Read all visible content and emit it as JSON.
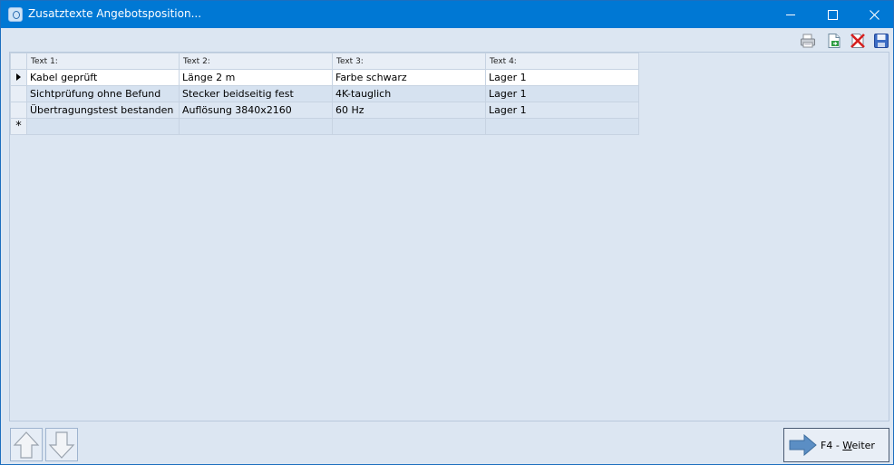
{
  "window": {
    "title": "Zusatztexte Angebotsposition...",
    "controls": [
      "minimize-icon",
      "maximize-icon",
      "close-icon"
    ]
  },
  "toolbar": {
    "icons": [
      "printer-icon",
      "export-sheet-icon",
      "delete-icon",
      "save-disk-icon"
    ]
  },
  "grid": {
    "columns": [
      "Text 1:",
      "Text 2:",
      "Text 3:",
      "Text 4:"
    ],
    "rows": [
      [
        "Kabel geprüft",
        "Länge 2 m",
        "Farbe schwarz",
        "Lager 1"
      ],
      [
        "Sichtprüfung ohne Befund",
        "Stecker beidseitig fest",
        "4K-tauglich",
        "Lager 1"
      ],
      [
        "Übertragungstest bestanden",
        "Auflösung 3840x2160",
        "60 Hz",
        "Lager 1"
      ]
    ],
    "current_row_marker": "row-pointer-icon",
    "new_row_marker": "*"
  },
  "footer": {
    "weiter_prefix": "F4 - ",
    "weiter_underlined": "W",
    "weiter_rest": "eiter"
  },
  "colors": {
    "titlebar": "#0078d4",
    "background": "#dce6f2",
    "arrow": "#5b8ec4"
  }
}
